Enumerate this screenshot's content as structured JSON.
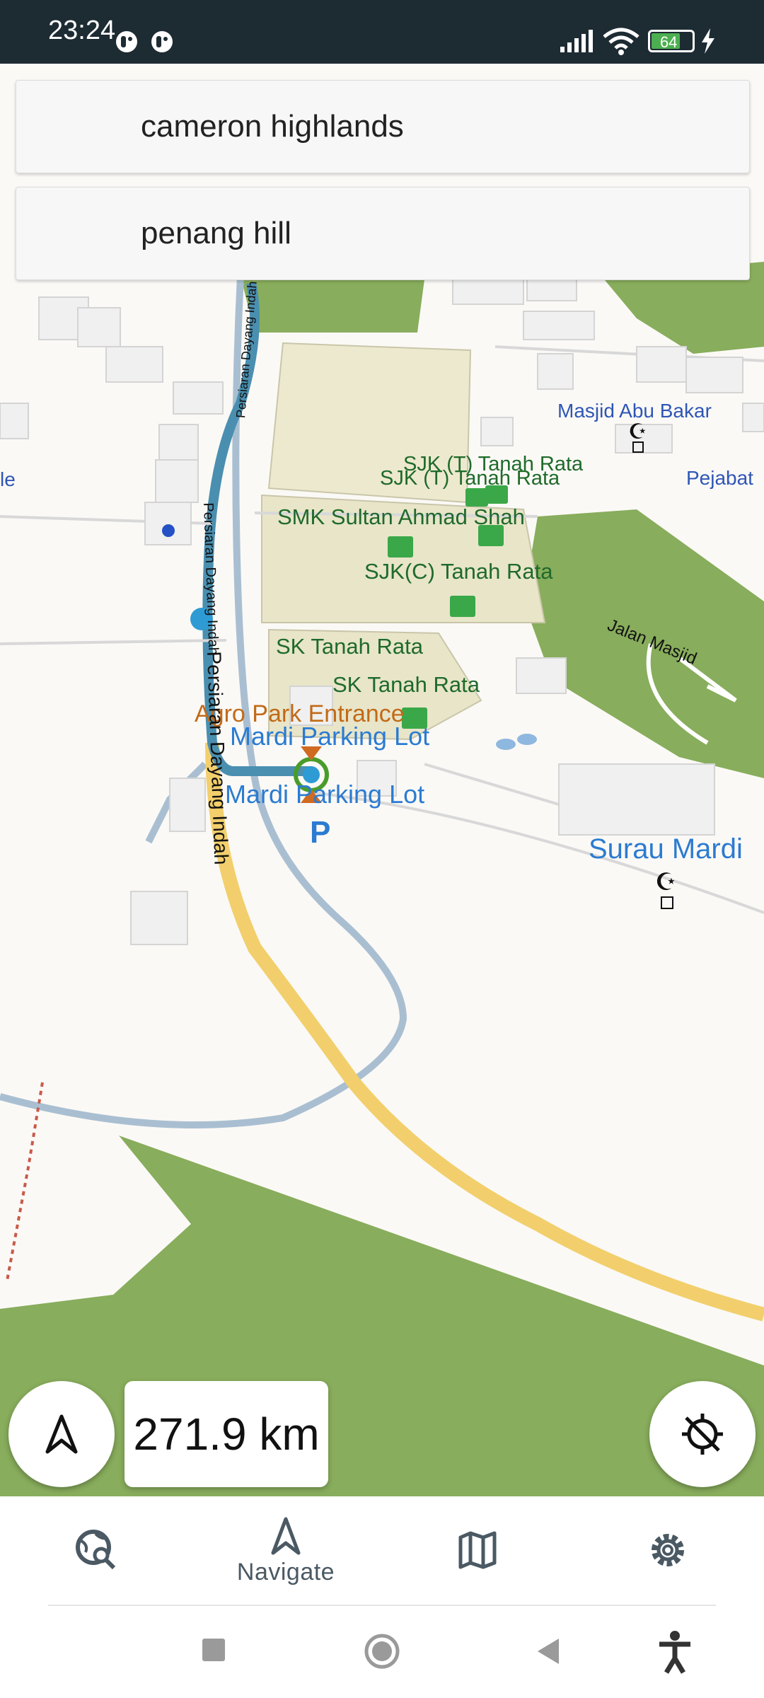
{
  "status_bar": {
    "time": "23:24",
    "battery_level": "64"
  },
  "search_results": [
    {
      "label": "cameron highlands"
    },
    {
      "label": "penang hill"
    }
  ],
  "map": {
    "labels": {
      "masjid_abu_bakar": "Masjid Abu Bakar",
      "pejabat": "Pejabat",
      "le": "le",
      "sjk_t_1": "SJK (T) Tanah Rata",
      "sjk_t_2": "SJK (T) Tanah Rata",
      "smk_sultan": "SMK Sultan Ahmad Shah",
      "sjk_c": "SJK(C) Tanah Rata",
      "sk_1": "SK Tanah Rata",
      "sk_2": "SK Tanah Rata",
      "agro_park": "Agro Park Entrance",
      "mardi_parking_1": "Mardi Parking Lot",
      "mardi_parking_2": "Mardi Parking Lot",
      "parking_p": "P",
      "surau_mardi": "Surau Mardi",
      "jalan_masjid": "Jalan Masjid",
      "road_1": "Persiaran Dayang Indah",
      "road_2": "Persiaran Dayang Indah",
      "road_3": "Persiaran Dayang Indah"
    }
  },
  "distance": "271.9 km",
  "bottom_nav": {
    "items": [
      {
        "icon": "search-globe-icon",
        "label": ""
      },
      {
        "icon": "navigate-icon",
        "label": "Navigate"
      },
      {
        "icon": "map-icon",
        "label": ""
      },
      {
        "icon": "settings-icon",
        "label": ""
      }
    ]
  },
  "colors": {
    "status_bar": "#1d2b33",
    "park_green": "#88ad5c",
    "school_area": "#ece9cf",
    "main_road": "#f2cf6c",
    "route": "#4a8fb0",
    "secondary_road": "#a9bfd1",
    "label_blue": "#2b7bd1",
    "label_green": "#1f6a2a",
    "label_orange": "#c26a18"
  }
}
